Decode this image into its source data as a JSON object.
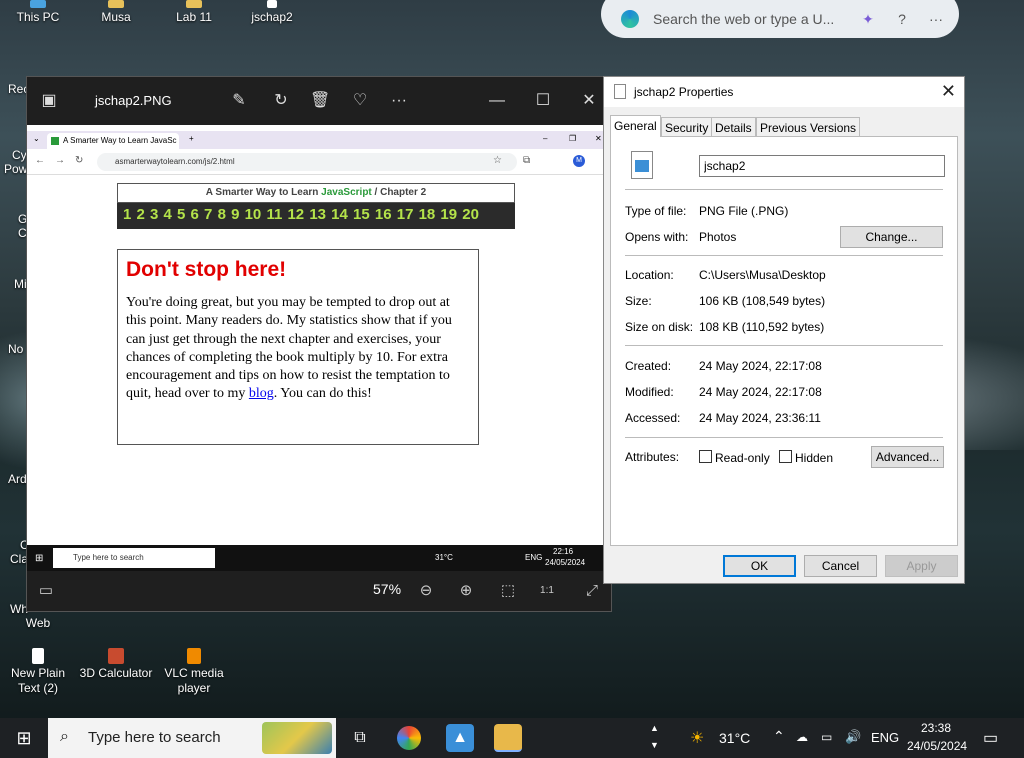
{
  "desktop_icons": [
    {
      "label": "This PC"
    },
    {
      "label": "Musa"
    },
    {
      "label": "Lab 11"
    },
    {
      "label": "jschap2"
    },
    {
      "label": "New Plain Text (2)"
    },
    {
      "label": "3D Calculator"
    },
    {
      "label": "VLC media player"
    },
    {
      "label": "Web"
    }
  ],
  "side_labels": [
    "Rec",
    "Cy",
    "Pow",
    "G",
    "C",
    "Mi",
    "No",
    "Ard",
    "C",
    "Cla",
    "Wh"
  ],
  "edge_search": {
    "placeholder": "Search the web or type a U..."
  },
  "photos": {
    "filename": "jschap2.PNG",
    "zoom": "57%",
    "browser": {
      "tab_title": "A Smarter Way to Learn JavaSc",
      "url": "asmarterwaytolearn.com/js/2.html",
      "header_prefix": "A Smarter Way to Learn ",
      "header_js": "JavaScript",
      "header_suffix": "  /  Chapter 2",
      "chapter_numbers": "1 2 3 4 5 6 7 8 9 10 11 12 13 14 15 16 17 18 19 20",
      "heading": "Don't stop here!",
      "body_text": "You're doing great, but you may be tempted to drop out at this point. Many readers do. My statistics show that if you can just get through the next chapter and exercises, your chances of completing the book multiply by 10. For extra encouragement and tips on how to resist the temptation to quit, head over to my ",
      "link_text": "blog",
      "body_tail": ". You can do this!",
      "inner_taskbar": {
        "search": "Type here to search",
        "temp": "31°C",
        "lang": "ENG",
        "time": "22:16",
        "date": "24/05/2024"
      }
    }
  },
  "properties": {
    "title": "jschap2 Properties",
    "tabs": [
      "General",
      "Security",
      "Details",
      "Previous Versions"
    ],
    "name": "jschap2",
    "type_label": "Type of file:",
    "type_value": "PNG File (.PNG)",
    "opens_label": "Opens with:",
    "opens_value": "Photos",
    "change_btn": "Change...",
    "location_label": "Location:",
    "location_value": "C:\\Users\\Musa\\Desktop",
    "size_label": "Size:",
    "size_value": "106 KB (108,549 bytes)",
    "disk_label": "Size on disk:",
    "disk_value": "108 KB (110,592 bytes)",
    "created_label": "Created:",
    "created_value": "24 May 2024, 22:17:08",
    "modified_label": "Modified:",
    "modified_value": "24 May 2024, 22:17:08",
    "accessed_label": "Accessed:",
    "accessed_value": "24 May 2024, 23:36:11",
    "attributes_label": "Attributes:",
    "readonly": "Read-only",
    "hidden": "Hidden",
    "advanced_btn": "Advanced...",
    "ok": "OK",
    "cancel": "Cancel",
    "apply": "Apply"
  },
  "taskbar": {
    "search": "Type here to search",
    "temp": "31°C",
    "lang": "ENG",
    "time": "23:38",
    "date": "24/05/2024"
  }
}
